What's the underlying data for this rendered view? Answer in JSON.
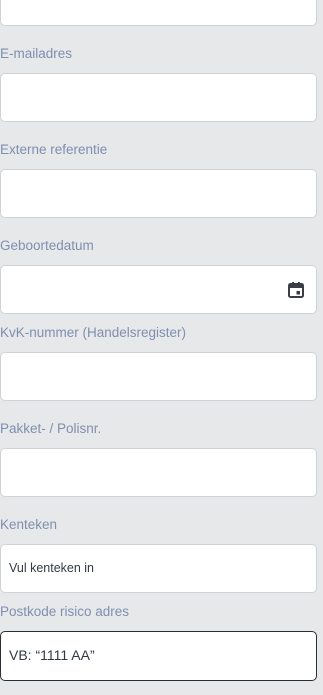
{
  "form": {
    "email_label": "E-mailadres",
    "external_ref_label": "Externe referentie",
    "birthdate_label": "Geboortedatum",
    "kvk_label": "KvK-nummer (Handelsregister)",
    "policy_label": "Pakket- / Polisnr.",
    "license_plate_label": "Kenteken",
    "license_plate_placeholder": "Vul kenteken in",
    "postcode_label": "Postkode risico adres",
    "postcode_placeholder": "VB: “1111 AA”",
    "calendar_icon": "calendar-icon"
  }
}
